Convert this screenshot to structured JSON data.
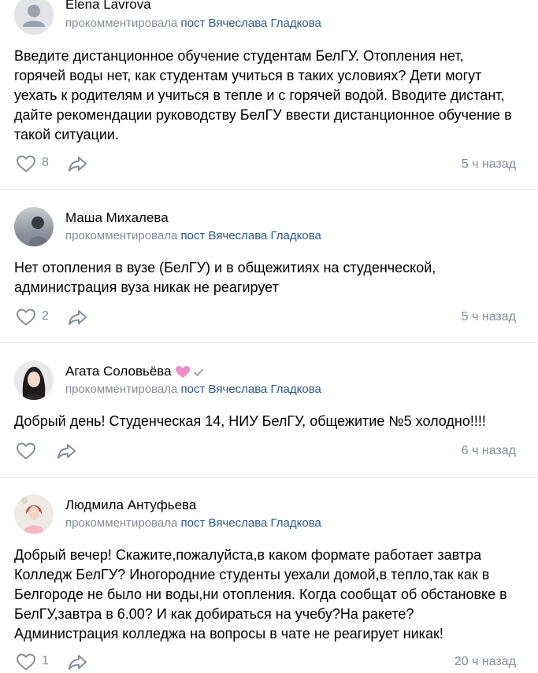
{
  "comments": [
    {
      "author": "Elena Lavrova",
      "action": "прокомментировала",
      "post_link": "пост Вячеслава Гладкова",
      "text": "Введите дистанционное обучение студентам БелГУ. Отопления нет, горячей воды нет, как студентам учиться в таких условиях? Дети могут уехать к родителям и учиться в тепле и с горячей водой. Вводите дистант, дайте рекомендации руководству БелГУ ввести дистанционное обучение в такой ситуации.",
      "likes": "8",
      "time": "5 ч назад"
    },
    {
      "author": "Маша Михалева",
      "action": "прокомментировала",
      "post_link": "пост Вячеслава Гладкова",
      "text": "Нет отопления в вузе (БелГУ) и в общежитиях на студенческой, администрация вуза никак не реагирует",
      "likes": "2",
      "time": "5 ч назад"
    },
    {
      "author": "Агата Соловьёва",
      "action": "прокомментировала",
      "post_link": "пост Вячеслава Гладкова",
      "text": "Добрый день! Студенческая 14, НИУ БелГУ, общежитие №5 холодно!!!!",
      "likes": "",
      "time": "6 ч назад"
    },
    {
      "author": "Людмила Антуфьева",
      "action": "прокомментировала",
      "post_link": "пост Вячеслава Гладкова",
      "text": "Добрый вечер! Скажите,пожалуйста,в каком формате работает завтра Колледж БелГУ? Иногородние студенты уехали домой,в тепло,так как в Белгороде не было ни воды,ни отопления. Когда сообщат об обстановке в БелГУ,завтра в 6.00? И как добираться на учебу?На ракете? Администрация колледжа на вопросы в чате не реагирует никак!",
      "likes": "1",
      "time": "20 ч назад"
    }
  ],
  "icons": {
    "like": "heart-outline-icon",
    "share": "share-arrow-icon",
    "verified": "check-icon",
    "status": "pink-heart-icon"
  },
  "colors": {
    "link": "#2a5885",
    "meta": "#818c99",
    "divider": "#e7e8ec"
  }
}
